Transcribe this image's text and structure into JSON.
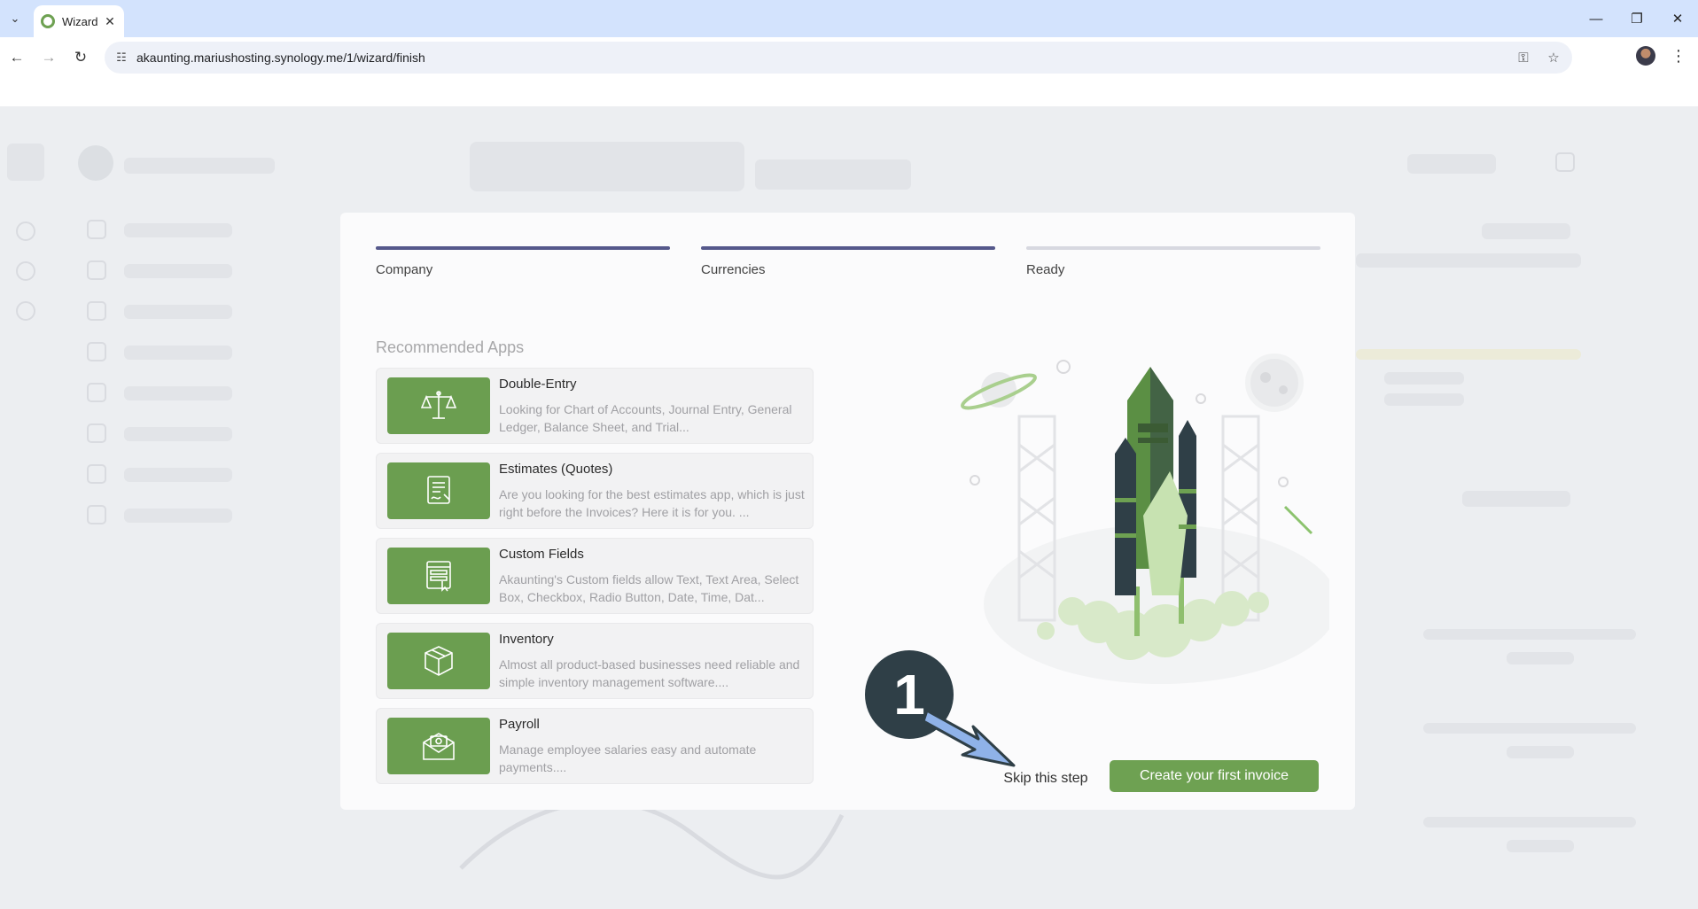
{
  "browser": {
    "tab_title": "Wizard",
    "url": "akaunting.mariushosting.synology.me/1/wizard/finish"
  },
  "wizard": {
    "steps": [
      {
        "label": "Company",
        "state": "done"
      },
      {
        "label": "Currencies",
        "state": "done"
      },
      {
        "label": "Ready",
        "state": "pending"
      }
    ],
    "section_title": "Recommended Apps",
    "apps": [
      {
        "name": "Double-Entry",
        "description": "Looking for Chart of Accounts, Journal Entry, General Ledger, Balance Sheet, and Trial...",
        "icon": "scales-icon"
      },
      {
        "name": "Estimates (Quotes)",
        "description": "Are you looking for the best estimates app, which is just right before the Invoices? Here it is for you. ...",
        "icon": "signed-document-icon"
      },
      {
        "name": "Custom Fields",
        "description": "Akaunting's Custom fields allow Text, Text Area, Select Box, Checkbox, Radio Button, Date, Time, Dat...",
        "icon": "form-cursor-icon"
      },
      {
        "name": "Inventory",
        "description": "Almost all product-based businesses need reliable and simple inventory management software....",
        "icon": "box-icon"
      },
      {
        "name": "Payroll",
        "description": "Manage employee salaries easy and automate payments....",
        "icon": "money-envelope-icon"
      }
    ],
    "skip_label": "Skip this step",
    "create_label": "Create your first invoice"
  },
  "annotation": {
    "marker": "1"
  },
  "colors": {
    "accent_green": "#6ea152",
    "step_done": "#55588b",
    "step_pending": "#d7d8e0",
    "marker": "#2f3f47",
    "arrow": "#8fb2e8"
  }
}
